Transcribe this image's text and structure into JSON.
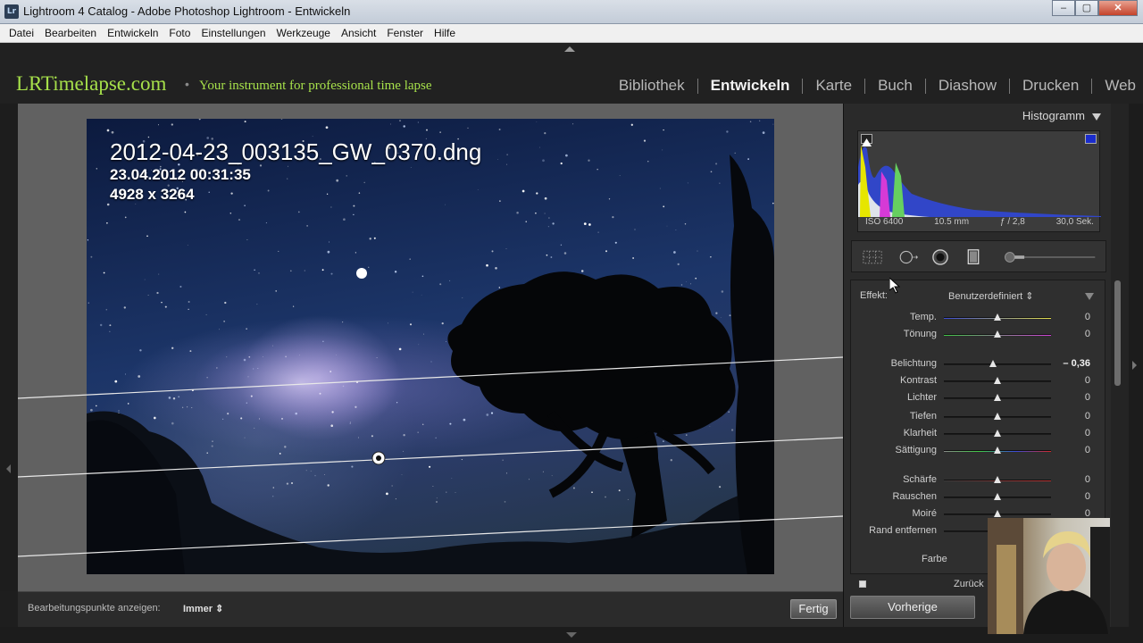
{
  "window": {
    "app_icon": "Lr",
    "title": "Lightroom 4 Catalog - Adobe Photoshop Lightroom - Entwickeln"
  },
  "menu": [
    "Datei",
    "Bearbeiten",
    "Entwickeln",
    "Foto",
    "Einstellungen",
    "Werkzeuge",
    "Ansicht",
    "Fenster",
    "Hilfe"
  ],
  "identity": {
    "brand": "LRTimelapse.com",
    "separator": "•",
    "tagline": "Your instrument for professional time lapse"
  },
  "modules": [
    {
      "label": "Bibliothek",
      "active": false
    },
    {
      "label": "Entwickeln",
      "active": true
    },
    {
      "label": "Karte",
      "active": false
    },
    {
      "label": "Buch",
      "active": false
    },
    {
      "label": "Diashow",
      "active": false
    },
    {
      "label": "Drucken",
      "active": false
    },
    {
      "label": "Web",
      "active": false
    }
  ],
  "photo": {
    "filename": "2012-04-23_003135_GW_0370.dng",
    "datetime": "23.04.2012 00:31:35",
    "dimensions": "4928 x 3264"
  },
  "toolbar": {
    "label": "Bearbeitungspunkte anzeigen:",
    "value": "Immer",
    "done_button": "Fertig"
  },
  "histogram": {
    "title": "Histogramm",
    "iso": "ISO 6400",
    "focal": "10.5 mm",
    "aperture": "ƒ / 2,8",
    "shutter": "30,0 Sek."
  },
  "tools": [
    "crop-overlay-icon",
    "spot-removal-icon",
    "red-eye-icon",
    "graduated-filter-icon",
    "adjustment-brush-icon"
  ],
  "effect": {
    "label": "Effekt:",
    "value": "Benutzerdefiniert ⇕"
  },
  "sliders": [
    {
      "label": "Temp.",
      "value": "0",
      "pos": 0.5,
      "track": "temp"
    },
    {
      "label": "Tönung",
      "value": "0",
      "pos": 0.5,
      "track": "tint"
    },
    {
      "label": "Belichtung",
      "value": "– 0,36",
      "pos": 0.46,
      "track": "plain",
      "bold": true
    },
    {
      "label": "Kontrast",
      "value": "0",
      "pos": 0.5,
      "track": "plain"
    },
    {
      "label": "Lichter",
      "value": "0",
      "pos": 0.5,
      "track": "plain"
    },
    {
      "label": "Tiefen",
      "value": "0",
      "pos": 0.5,
      "track": "plain"
    },
    {
      "label": "Klarheit",
      "value": "0",
      "pos": 0.5,
      "track": "plain"
    },
    {
      "label": "Sättigung",
      "value": "0",
      "pos": 0.5,
      "track": "sat"
    },
    {
      "label": "Schärfe",
      "value": "0",
      "pos": 0.5,
      "track": "sharp"
    },
    {
      "label": "Rauschen",
      "value": "0",
      "pos": 0.5,
      "track": "plain"
    },
    {
      "label": "Moiré",
      "value": "0",
      "pos": 0.5,
      "track": "plain"
    },
    {
      "label": "Rand entfernen",
      "value": "",
      "pos": 0.5,
      "track": "plain"
    }
  ],
  "panel_footer": {
    "color_label": "Farbe",
    "reset_label": "Zurück",
    "prev_button": "Vorherige"
  },
  "colors": {
    "accent_green": "#a6e04a",
    "panel_bg": "#2a2a2a"
  }
}
